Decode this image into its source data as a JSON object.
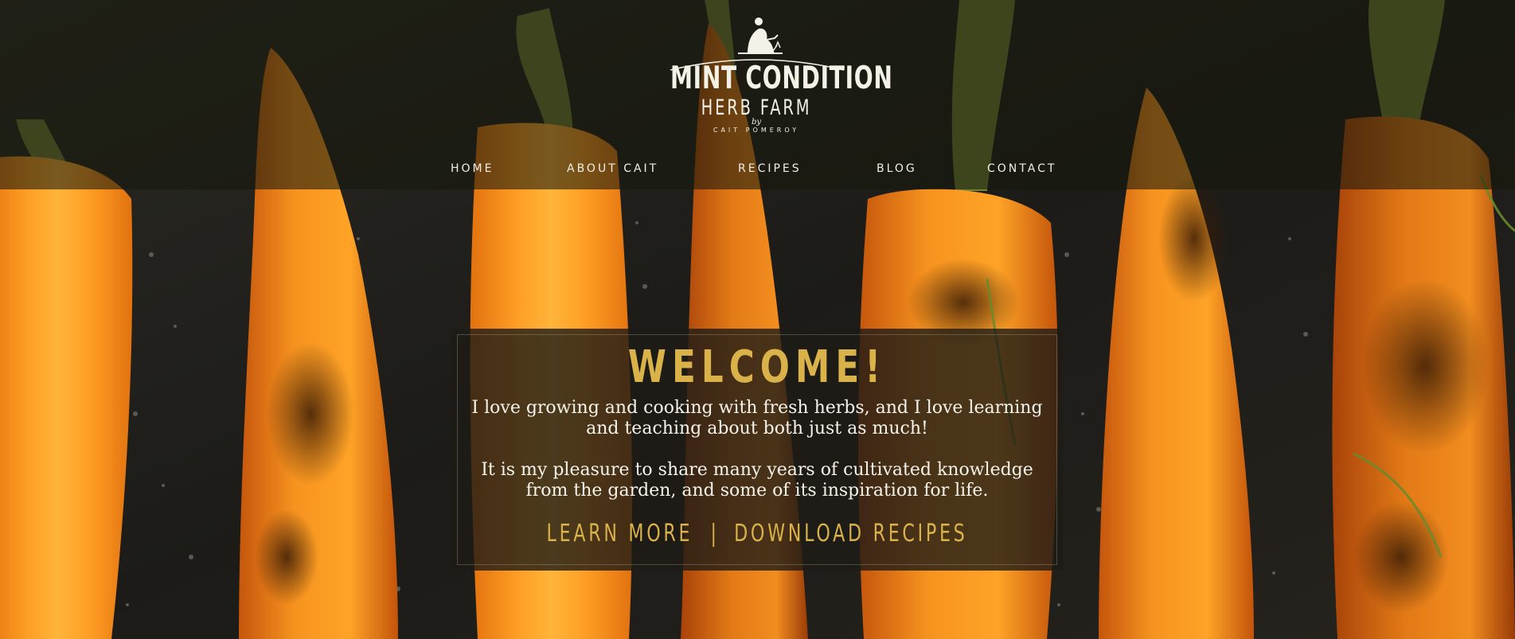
{
  "brand": {
    "title": "MINT CONDITION",
    "subtitle": "HERB FARM",
    "by": "by",
    "author": "CAIT POMEROY",
    "logo_icon": "gardener-icon"
  },
  "nav": {
    "items": [
      {
        "label": "HOME"
      },
      {
        "label": "ABOUT CAIT"
      },
      {
        "label": "RECIPES"
      },
      {
        "label": "BLOG"
      },
      {
        "label": "CONTACT"
      }
    ]
  },
  "welcome": {
    "title": "WELCOME!",
    "paragraph_1": "I love growing and cooking with fresh herbs, and I love learning and teaching about both just as much!",
    "paragraph_2": "It is my pleasure to share many years of cultivated knowledge from the garden, and some of its inspiration for life.",
    "learn_more": "LEARN MORE",
    "separator": "|",
    "download": "DOWNLOAD RECIPES"
  },
  "colors": {
    "accent_gold": "#d9b24a",
    "header_overlay": "#16180c",
    "text_light": "#f6f3ea",
    "carrot_orange": "#f08a1c"
  }
}
